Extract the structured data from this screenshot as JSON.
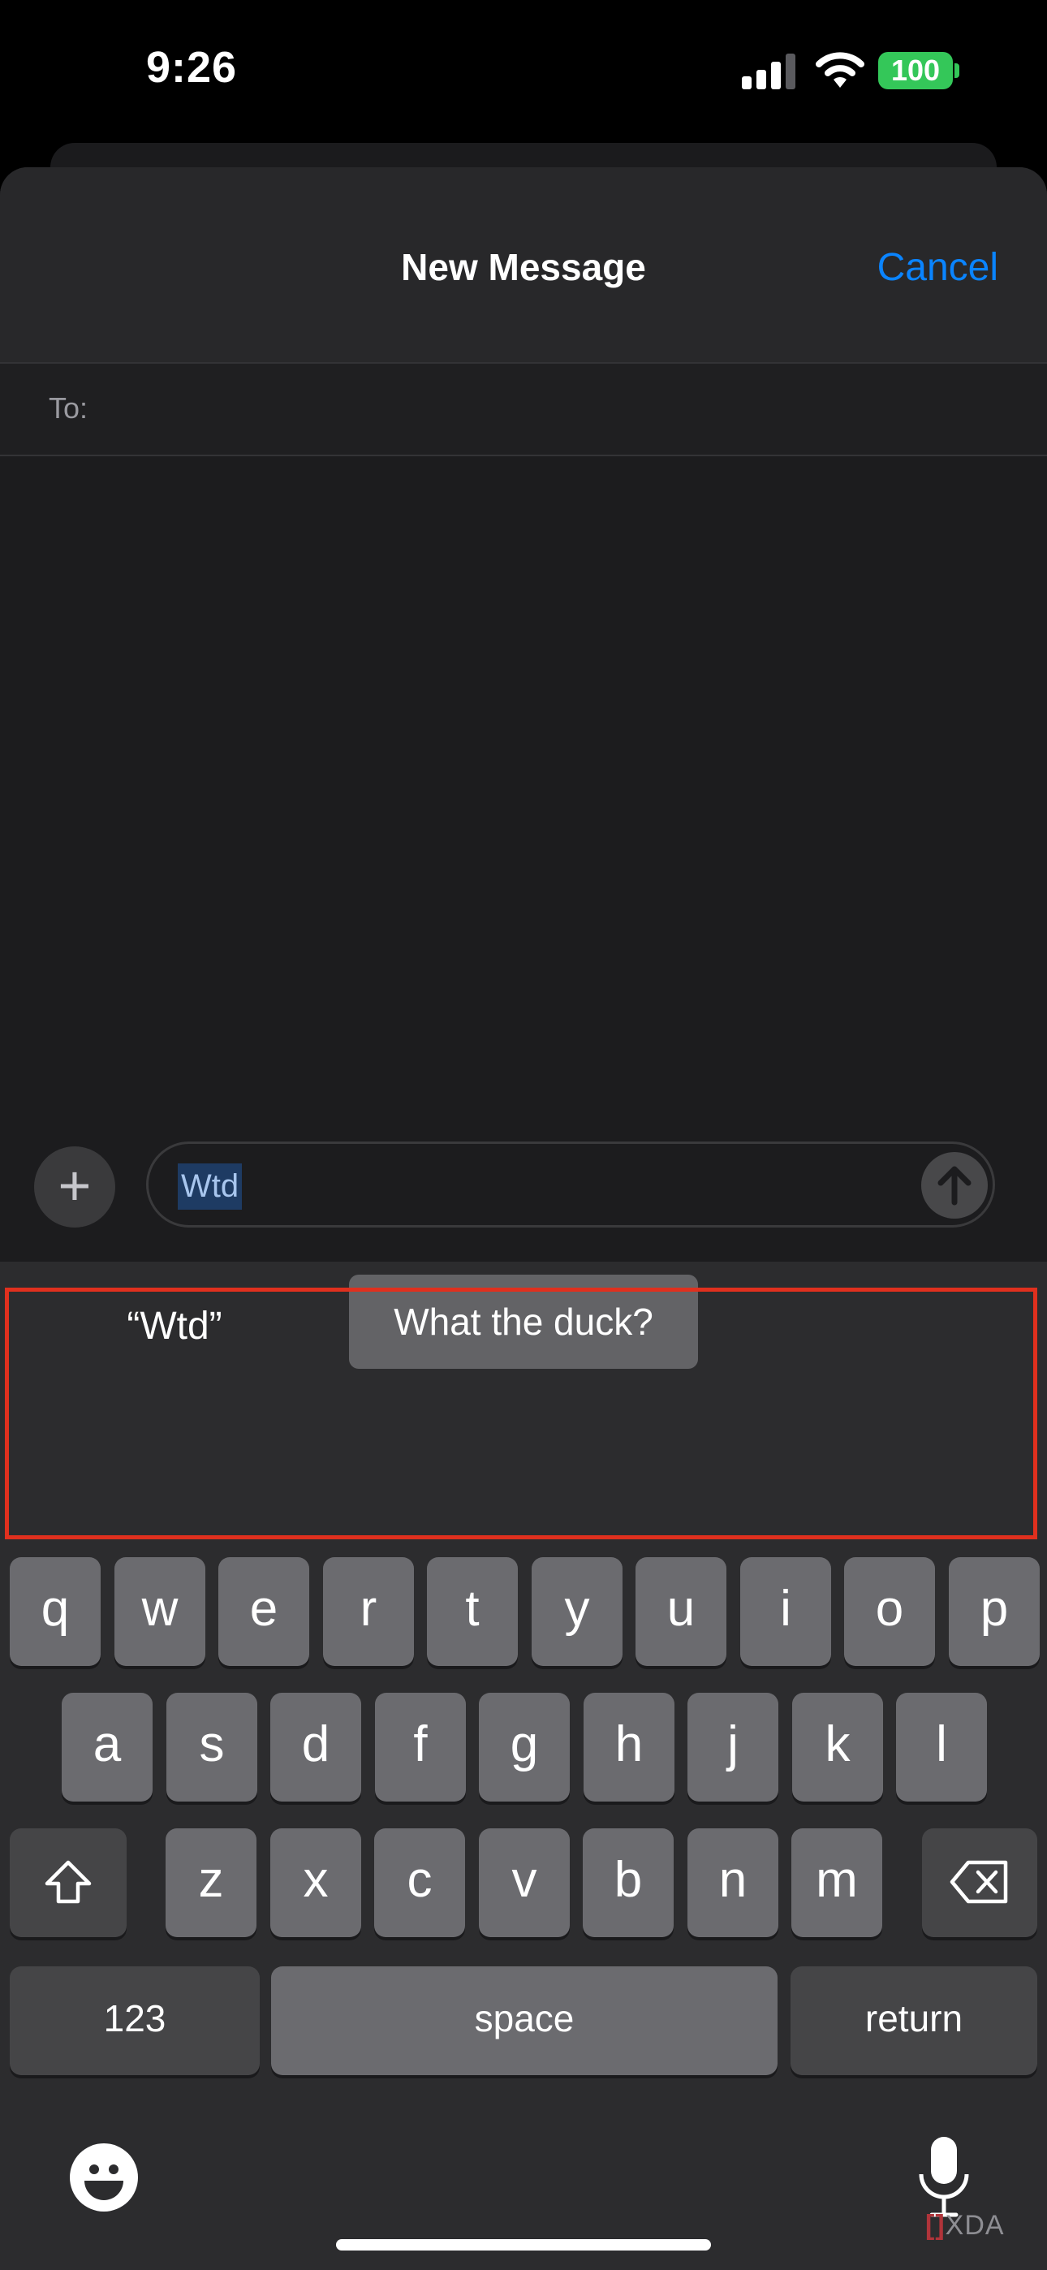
{
  "status_bar": {
    "time": "9:26",
    "battery": "100"
  },
  "header": {
    "title": "New Message",
    "cancel_label": "Cancel"
  },
  "recipient": {
    "to_label": "To:"
  },
  "compose": {
    "message_text": "Wtd"
  },
  "suggestions": {
    "quoted": "“Wtd”",
    "expansion": "What the duck?"
  },
  "keyboard": {
    "row1": [
      "q",
      "w",
      "e",
      "r",
      "t",
      "y",
      "u",
      "i",
      "o",
      "p"
    ],
    "row2": [
      "a",
      "s",
      "d",
      "f",
      "g",
      "h",
      "j",
      "k",
      "l"
    ],
    "row3": [
      "z",
      "x",
      "c",
      "v",
      "b",
      "n",
      "m"
    ],
    "numbers_label": "123",
    "space_label": "space",
    "return_label": "return"
  },
  "watermark": "XDA",
  "colors": {
    "accent": "#0a84ff",
    "highlight_border": "#e0301e",
    "battery": "#34c759"
  }
}
